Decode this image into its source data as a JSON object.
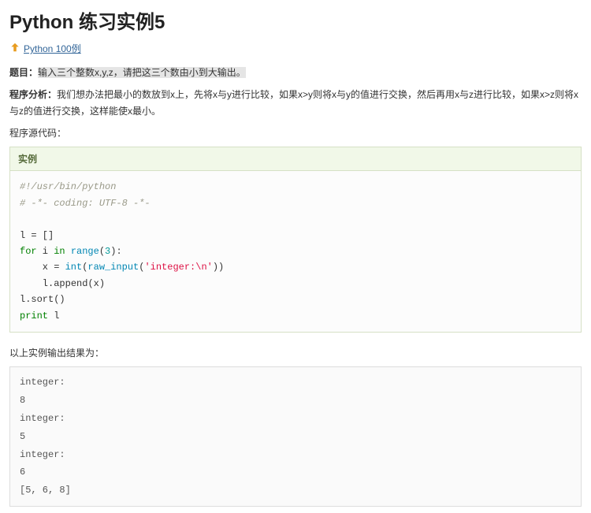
{
  "title": "Python 练习实例5",
  "backLink": "Python 100例",
  "topic": {
    "label": "题目：",
    "text": "输入三个整数x,y,z，请把这三个数由小到大输出。"
  },
  "analysis": {
    "label": "程序分析：",
    "text": "我们想办法把最小的数放到x上，先将x与y进行比较，如果x>y则将x与y的值进行交换，然后再用x与z进行比较，如果x>z则将x与z的值进行交换，这样能使x最小。"
  },
  "sourceLabel": "程序源代码：",
  "exampleLabel": "实例",
  "code": {
    "line1": "#!/usr/bin/python",
    "line2": "# -*- coding: UTF-8 -*-",
    "line3": "l = []",
    "line4_for": "for",
    "line4_in": "in",
    "line4_range": "range",
    "line4_num": "3",
    "line4_rest": "(",
    "line4_after": "):",
    "line5_var": "    x = ",
    "line5_int": "int",
    "line5_p1": "(",
    "line5_raw": "raw_input",
    "line5_p2": "(",
    "line5_str": "'integer:\\n'",
    "line5_p3": "))",
    "line6": "    l.append(x)",
    "line6_l": "    l.",
    "line6_ap": "append",
    "line6_px": "(x)",
    "line7_l": "l.",
    "line7_sort": "sort",
    "line7_p": "()",
    "line8_print": "print",
    "line8_l": " l"
  },
  "outputLabel": "以上实例输出结果为：",
  "output": "integer:\n8\ninteger:\n5\ninteger:\n6\n[5, 6, 8]"
}
